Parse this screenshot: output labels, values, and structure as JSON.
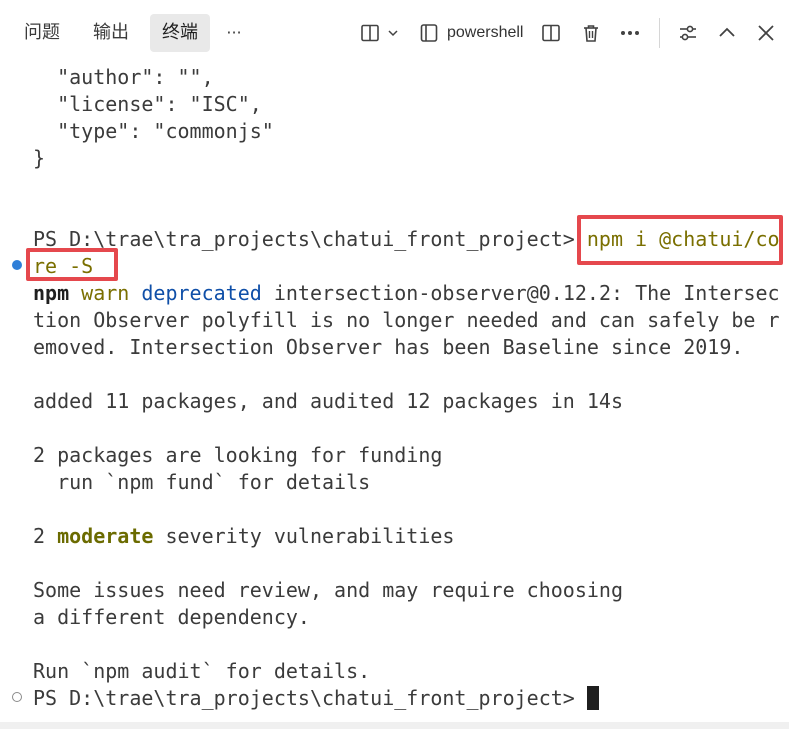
{
  "tabs": [
    {
      "label": "问题"
    },
    {
      "label": "输出"
    },
    {
      "label": "终端",
      "active": true
    },
    {
      "label": "···"
    }
  ],
  "toolbar": {
    "shell_name": "powershell",
    "icons": [
      "split-terminal-icon",
      "chevron-down-icon",
      "shell-icon",
      "split-editor-icon",
      "trash-icon",
      "more-icon",
      "tune-icon",
      "chevron-up-icon",
      "close-icon"
    ]
  },
  "terminal": {
    "lines": {
      "l1": "  \"author\": \"\",",
      "l2": "  \"license\": \"ISC\",",
      "l3": "  \"type\": \"commonjs\"",
      "l4": "}",
      "prompt1": "PS D:\\trae\\tra_projects\\chatui_front_project> ",
      "cmd_part1": "npm i @chatui/co",
      "cmd_part2": "re -S",
      "warn_npm": "npm",
      "warn_warn": "warn",
      "warn_deprecated": "deprecated",
      "warn_rest": " intersection-observer@0.12.2: The Intersec",
      "warn_l2": "tion Observer polyfill is no longer needed and can safely be r",
      "warn_l3": "emoved. Intersection Observer has been Baseline since 2019.",
      "added": "added 11 packages, and audited 12 packages in 14s",
      "funding1": "2 packages are looking for funding",
      "funding2": "  run `npm fund` for details",
      "vuln_count": "2 ",
      "vuln_moderate": "moderate",
      "vuln_rest": " severity vulnerabilities",
      "issues1": "Some issues need review, and may require choosing",
      "issues2": "a different dependency.",
      "audit": "Run `npm audit` for details.",
      "prompt2": "PS D:\\trae\\tra_projects\\chatui_front_project> "
    }
  },
  "colors": {
    "highlight_box": "#e5484d",
    "command_text": "#7a6f00",
    "deprecated_text": "#0f4fa8",
    "success_dot": "#2f7fd8"
  }
}
